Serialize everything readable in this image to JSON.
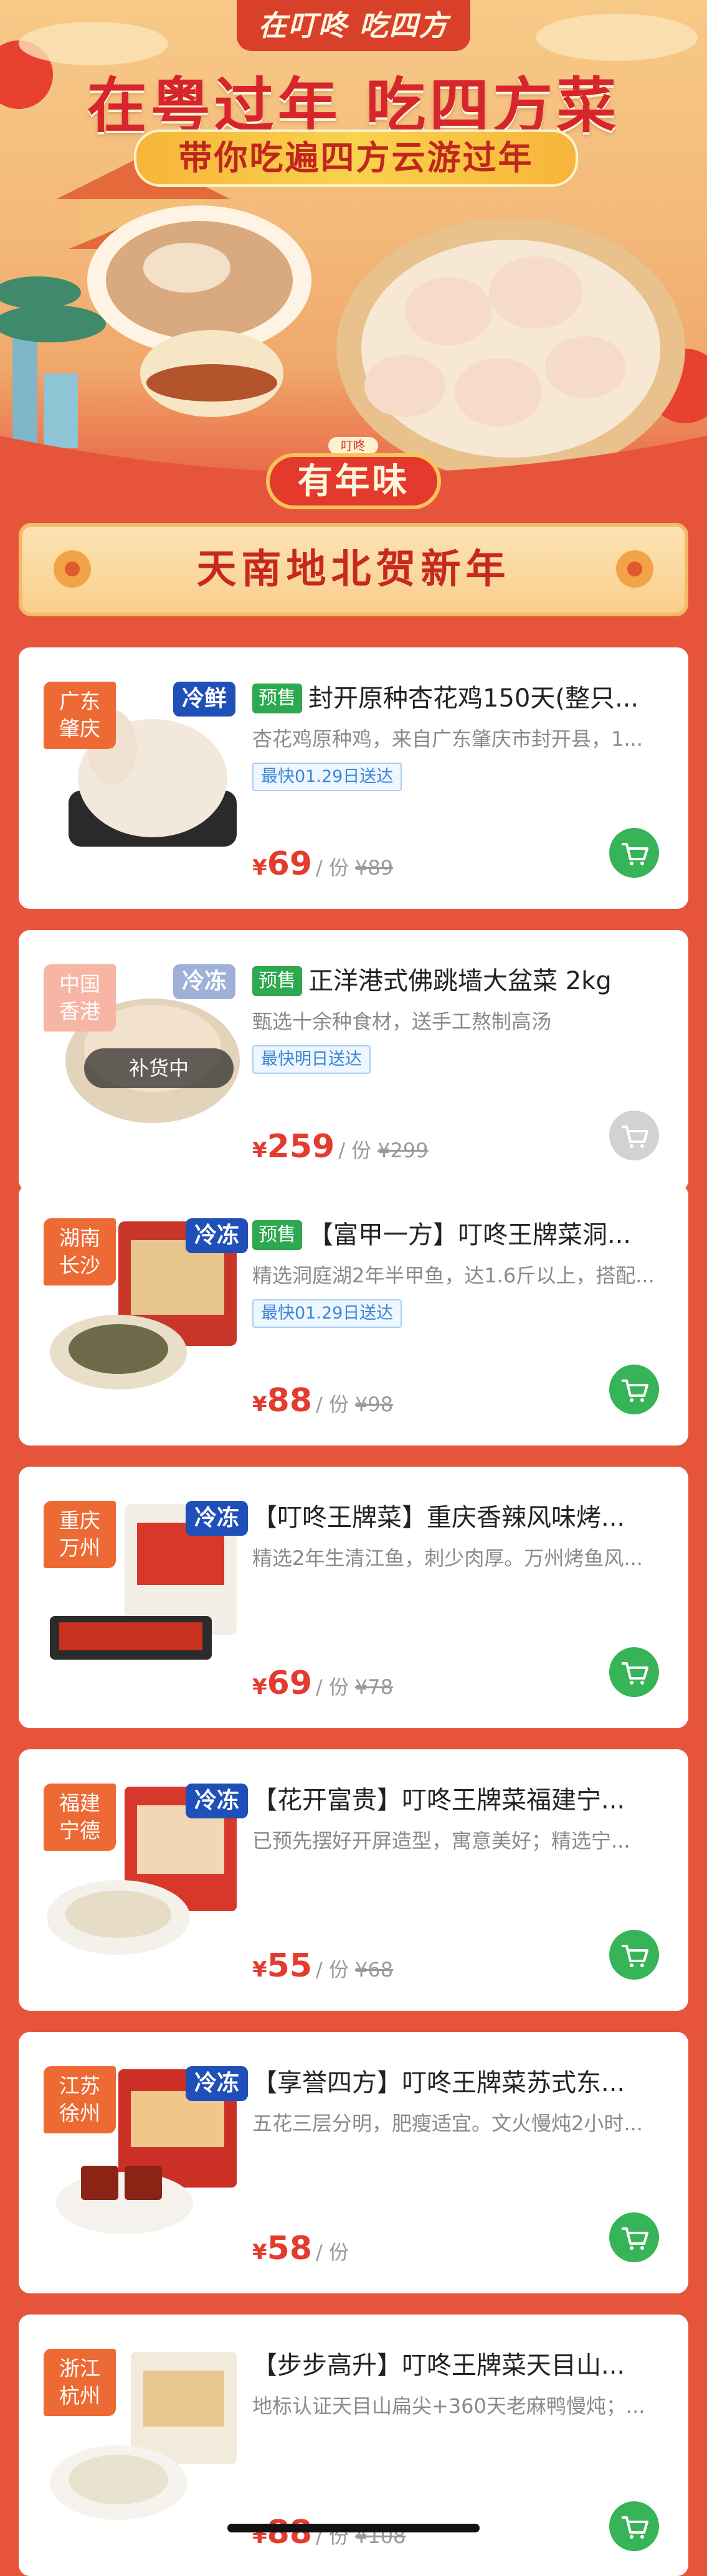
{
  "hero": {
    "tag": "在叮咚 吃四方",
    "title": "在粤过年 吃四方菜",
    "subtitle": "带你吃遍四方云游过年",
    "badge_small": "叮咚",
    "badge_main": "有年味"
  },
  "section": {
    "title": "天南地北贺新年"
  },
  "products": [
    {
      "region": [
        "广东",
        "肇庆"
      ],
      "temp": "冷鲜",
      "presale": "预售",
      "title": "封开原种杏花鸡150天(整只...",
      "desc": "杏花鸡原种鸡，来自广东肇庆市封开县，1...",
      "delivery": "最快01.29日送达",
      "price": "69",
      "unit": "/ 份",
      "orig": "¥89",
      "available": true
    },
    {
      "region": [
        "中国",
        "香港"
      ],
      "temp": "冷冻",
      "presale": "预售",
      "title": "正洋港式佛跳墙大盆菜 2kg",
      "desc": "甄选十余种食材，送手工熬制高汤",
      "delivery": "最快明日送达",
      "price": "259",
      "unit": "/ 份",
      "orig": "¥299",
      "restock": "补货中",
      "available": false
    },
    {
      "region": [
        "湖南",
        "长沙"
      ],
      "temp": "冷冻",
      "presale": "预售",
      "title": "【富甲一方】叮咚王牌菜洞...",
      "desc": "精选洞庭湖2年半甲鱼，达1.6斤以上，搭配...",
      "delivery": "最快01.29日送达",
      "price": "88",
      "unit": "/ 份",
      "orig": "¥98",
      "available": true
    },
    {
      "region": [
        "重庆",
        "万州"
      ],
      "temp": "冷冻",
      "title": "【叮咚王牌菜】重庆香辣风味烤...",
      "desc": "精选2年生清江鱼，刺少肉厚。万州烤鱼风...",
      "price": "69",
      "unit": "/ 份",
      "orig": "¥78",
      "available": true
    },
    {
      "region": [
        "福建",
        "宁德"
      ],
      "temp": "冷冻",
      "title": "【花开富贵】叮咚王牌菜福建宁...",
      "desc": "已预先摆好开屏造型，寓意美好；精选宁...",
      "price": "55",
      "unit": "/ 份",
      "orig": "¥68",
      "available": true
    },
    {
      "region": [
        "江苏",
        "徐州"
      ],
      "temp": "冷冻",
      "title": "【享誉四方】叮咚王牌菜苏式东...",
      "desc": "五花三层分明，肥瘦适宜。文火慢炖2小时...",
      "price": "58",
      "unit": "/ 份",
      "orig": "",
      "available": true
    },
    {
      "region": [
        "浙江",
        "杭州"
      ],
      "title": "【步步高升】叮咚王牌菜天目山...",
      "desc": "地标认证天目山扁尖+360天老麻鸭慢炖；...",
      "price": "88",
      "unit": "/ 份",
      "orig": "¥108",
      "available": true
    }
  ],
  "currency": "¥",
  "colors": {
    "page_bg": "#e6553b",
    "price": "#e43b2f",
    "cart": "#36b457",
    "temp_tag": "#1f4fb8",
    "region_tag": "#ee6a35",
    "presale": "#2da94f"
  },
  "icons": [
    "cart-icon",
    "flower-icon"
  ]
}
